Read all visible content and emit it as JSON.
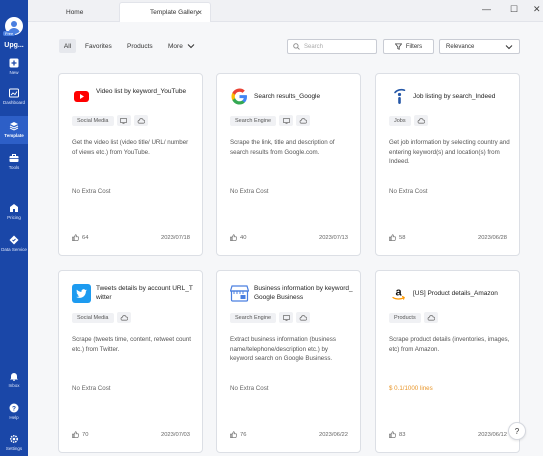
{
  "user": {
    "badge": "Free",
    "upgrade_label": "Upg..."
  },
  "sidebar": {
    "items": [
      {
        "label": "New",
        "icon": "plus-icon"
      },
      {
        "label": "Dashboard",
        "icon": "dashboard-icon"
      },
      {
        "label": "Template",
        "icon": "template-icon",
        "active": true
      },
      {
        "label": "Tools",
        "icon": "toolbox-icon"
      },
      {
        "label": "Pricing",
        "icon": "pricing-icon"
      },
      {
        "label": "Data Service",
        "icon": "data-service-icon"
      },
      {
        "label": "Inbox",
        "icon": "bell-icon"
      },
      {
        "label": "Help",
        "icon": "help-icon"
      },
      {
        "label": "Settings",
        "icon": "gear-icon"
      }
    ]
  },
  "tabs": {
    "home": "Home",
    "gallery": "Template Gallery",
    "close": "×"
  },
  "window": {
    "minimize": "—",
    "maximize": "☐",
    "close": "✕"
  },
  "filters": {
    "all": "All",
    "favorites": "Favorites",
    "products": "Products",
    "more": "More"
  },
  "search": {
    "placeholder": "Search"
  },
  "filters_button": "Filters",
  "sort": {
    "selected": "Relevance"
  },
  "cards": [
    {
      "title": "Video list by keyword_YouTube",
      "tag": "Social Media",
      "desc": "Get the video list (video title/ URL/ number of views etc.) from YouTube.",
      "cost": "No Extra Cost",
      "likes": "64",
      "date": "2023/07/18",
      "icon": "youtube-logo-icon"
    },
    {
      "title": "Search results_Google",
      "tag": "Search Engine",
      "desc": "Scrape the link, title and description of search results from Google.com.",
      "cost": "No Extra Cost",
      "likes": "40",
      "date": "2023/07/13",
      "icon": "google-logo-icon"
    },
    {
      "title": "Job listing by search_Indeed",
      "tag": "Jobs",
      "desc": "Get job information by selecting country and entering keyword(s) and location(s) from Indeed.",
      "cost": "No Extra Cost",
      "likes": "58",
      "date": "2023/06/28",
      "icon": "indeed-logo-icon"
    },
    {
      "title": "Tweets details by account URL_Twitter",
      "tag": "Social Media",
      "desc": "Scrape (tweets time, content, retweet count etc.) from Twitter.",
      "cost": "No Extra Cost",
      "likes": "70",
      "date": "2023/07/03",
      "icon": "twitter-logo-icon"
    },
    {
      "title": "Business information by keyword_Google Business",
      "tag": "Search Engine",
      "desc": "Extract business information (business name/telephone/description etc.) by keyword search on Google Business.",
      "cost": "No Extra Cost",
      "likes": "76",
      "date": "2023/06/22",
      "icon": "google-business-logo-icon"
    },
    {
      "title": "[US] Product details_Amazon",
      "tag": "Products",
      "desc": "Scrape product details (inventories, images, etc) from Amazon.",
      "cost": "$ 0.1/1000 lines",
      "likes": "83",
      "date": "2023/06/12",
      "icon": "amazon-logo-icon"
    }
  ],
  "help_button": "?",
  "colors": {
    "sidebar": "#1a47a8",
    "accent_price": "#e8962a",
    "youtube": "#ff0000",
    "twitter": "#1d9bf0"
  }
}
